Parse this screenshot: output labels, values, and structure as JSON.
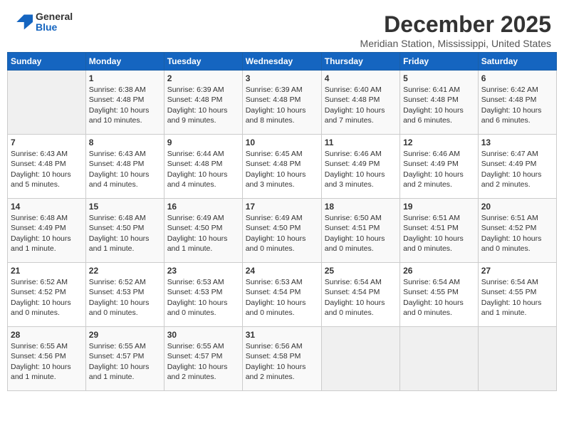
{
  "header": {
    "logo_general": "General",
    "logo_blue": "Blue",
    "month_title": "December 2025",
    "location": "Meridian Station, Mississippi, United States"
  },
  "weekdays": [
    "Sunday",
    "Monday",
    "Tuesday",
    "Wednesday",
    "Thursday",
    "Friday",
    "Saturday"
  ],
  "weeks": [
    [
      {
        "day": "",
        "sunrise": "",
        "sunset": "",
        "daylight": ""
      },
      {
        "day": "1",
        "sunrise": "Sunrise: 6:38 AM",
        "sunset": "Sunset: 4:48 PM",
        "daylight": "Daylight: 10 hours and 10 minutes."
      },
      {
        "day": "2",
        "sunrise": "Sunrise: 6:39 AM",
        "sunset": "Sunset: 4:48 PM",
        "daylight": "Daylight: 10 hours and 9 minutes."
      },
      {
        "day": "3",
        "sunrise": "Sunrise: 6:39 AM",
        "sunset": "Sunset: 4:48 PM",
        "daylight": "Daylight: 10 hours and 8 minutes."
      },
      {
        "day": "4",
        "sunrise": "Sunrise: 6:40 AM",
        "sunset": "Sunset: 4:48 PM",
        "daylight": "Daylight: 10 hours and 7 minutes."
      },
      {
        "day": "5",
        "sunrise": "Sunrise: 6:41 AM",
        "sunset": "Sunset: 4:48 PM",
        "daylight": "Daylight: 10 hours and 6 minutes."
      },
      {
        "day": "6",
        "sunrise": "Sunrise: 6:42 AM",
        "sunset": "Sunset: 4:48 PM",
        "daylight": "Daylight: 10 hours and 6 minutes."
      }
    ],
    [
      {
        "day": "7",
        "sunrise": "Sunrise: 6:43 AM",
        "sunset": "Sunset: 4:48 PM",
        "daylight": "Daylight: 10 hours and 5 minutes."
      },
      {
        "day": "8",
        "sunrise": "Sunrise: 6:43 AM",
        "sunset": "Sunset: 4:48 PM",
        "daylight": "Daylight: 10 hours and 4 minutes."
      },
      {
        "day": "9",
        "sunrise": "Sunrise: 6:44 AM",
        "sunset": "Sunset: 4:48 PM",
        "daylight": "Daylight: 10 hours and 4 minutes."
      },
      {
        "day": "10",
        "sunrise": "Sunrise: 6:45 AM",
        "sunset": "Sunset: 4:48 PM",
        "daylight": "Daylight: 10 hours and 3 minutes."
      },
      {
        "day": "11",
        "sunrise": "Sunrise: 6:46 AM",
        "sunset": "Sunset: 4:49 PM",
        "daylight": "Daylight: 10 hours and 3 minutes."
      },
      {
        "day": "12",
        "sunrise": "Sunrise: 6:46 AM",
        "sunset": "Sunset: 4:49 PM",
        "daylight": "Daylight: 10 hours and 2 minutes."
      },
      {
        "day": "13",
        "sunrise": "Sunrise: 6:47 AM",
        "sunset": "Sunset: 4:49 PM",
        "daylight": "Daylight: 10 hours and 2 minutes."
      }
    ],
    [
      {
        "day": "14",
        "sunrise": "Sunrise: 6:48 AM",
        "sunset": "Sunset: 4:49 PM",
        "daylight": "Daylight: 10 hours and 1 minute."
      },
      {
        "day": "15",
        "sunrise": "Sunrise: 6:48 AM",
        "sunset": "Sunset: 4:50 PM",
        "daylight": "Daylight: 10 hours and 1 minute."
      },
      {
        "day": "16",
        "sunrise": "Sunrise: 6:49 AM",
        "sunset": "Sunset: 4:50 PM",
        "daylight": "Daylight: 10 hours and 1 minute."
      },
      {
        "day": "17",
        "sunrise": "Sunrise: 6:49 AM",
        "sunset": "Sunset: 4:50 PM",
        "daylight": "Daylight: 10 hours and 0 minutes."
      },
      {
        "day": "18",
        "sunrise": "Sunrise: 6:50 AM",
        "sunset": "Sunset: 4:51 PM",
        "daylight": "Daylight: 10 hours and 0 minutes."
      },
      {
        "day": "19",
        "sunrise": "Sunrise: 6:51 AM",
        "sunset": "Sunset: 4:51 PM",
        "daylight": "Daylight: 10 hours and 0 minutes."
      },
      {
        "day": "20",
        "sunrise": "Sunrise: 6:51 AM",
        "sunset": "Sunset: 4:52 PM",
        "daylight": "Daylight: 10 hours and 0 minutes."
      }
    ],
    [
      {
        "day": "21",
        "sunrise": "Sunrise: 6:52 AM",
        "sunset": "Sunset: 4:52 PM",
        "daylight": "Daylight: 10 hours and 0 minutes."
      },
      {
        "day": "22",
        "sunrise": "Sunrise: 6:52 AM",
        "sunset": "Sunset: 4:53 PM",
        "daylight": "Daylight: 10 hours and 0 minutes."
      },
      {
        "day": "23",
        "sunrise": "Sunrise: 6:53 AM",
        "sunset": "Sunset: 4:53 PM",
        "daylight": "Daylight: 10 hours and 0 minutes."
      },
      {
        "day": "24",
        "sunrise": "Sunrise: 6:53 AM",
        "sunset": "Sunset: 4:54 PM",
        "daylight": "Daylight: 10 hours and 0 minutes."
      },
      {
        "day": "25",
        "sunrise": "Sunrise: 6:54 AM",
        "sunset": "Sunset: 4:54 PM",
        "daylight": "Daylight: 10 hours and 0 minutes."
      },
      {
        "day": "26",
        "sunrise": "Sunrise: 6:54 AM",
        "sunset": "Sunset: 4:55 PM",
        "daylight": "Daylight: 10 hours and 0 minutes."
      },
      {
        "day": "27",
        "sunrise": "Sunrise: 6:54 AM",
        "sunset": "Sunset: 4:55 PM",
        "daylight": "Daylight: 10 hours and 1 minute."
      }
    ],
    [
      {
        "day": "28",
        "sunrise": "Sunrise: 6:55 AM",
        "sunset": "Sunset: 4:56 PM",
        "daylight": "Daylight: 10 hours and 1 minute."
      },
      {
        "day": "29",
        "sunrise": "Sunrise: 6:55 AM",
        "sunset": "Sunset: 4:57 PM",
        "daylight": "Daylight: 10 hours and 1 minute."
      },
      {
        "day": "30",
        "sunrise": "Sunrise: 6:55 AM",
        "sunset": "Sunset: 4:57 PM",
        "daylight": "Daylight: 10 hours and 2 minutes."
      },
      {
        "day": "31",
        "sunrise": "Sunrise: 6:56 AM",
        "sunset": "Sunset: 4:58 PM",
        "daylight": "Daylight: 10 hours and 2 minutes."
      },
      {
        "day": "",
        "sunrise": "",
        "sunset": "",
        "daylight": ""
      },
      {
        "day": "",
        "sunrise": "",
        "sunset": "",
        "daylight": ""
      },
      {
        "day": "",
        "sunrise": "",
        "sunset": "",
        "daylight": ""
      }
    ]
  ]
}
